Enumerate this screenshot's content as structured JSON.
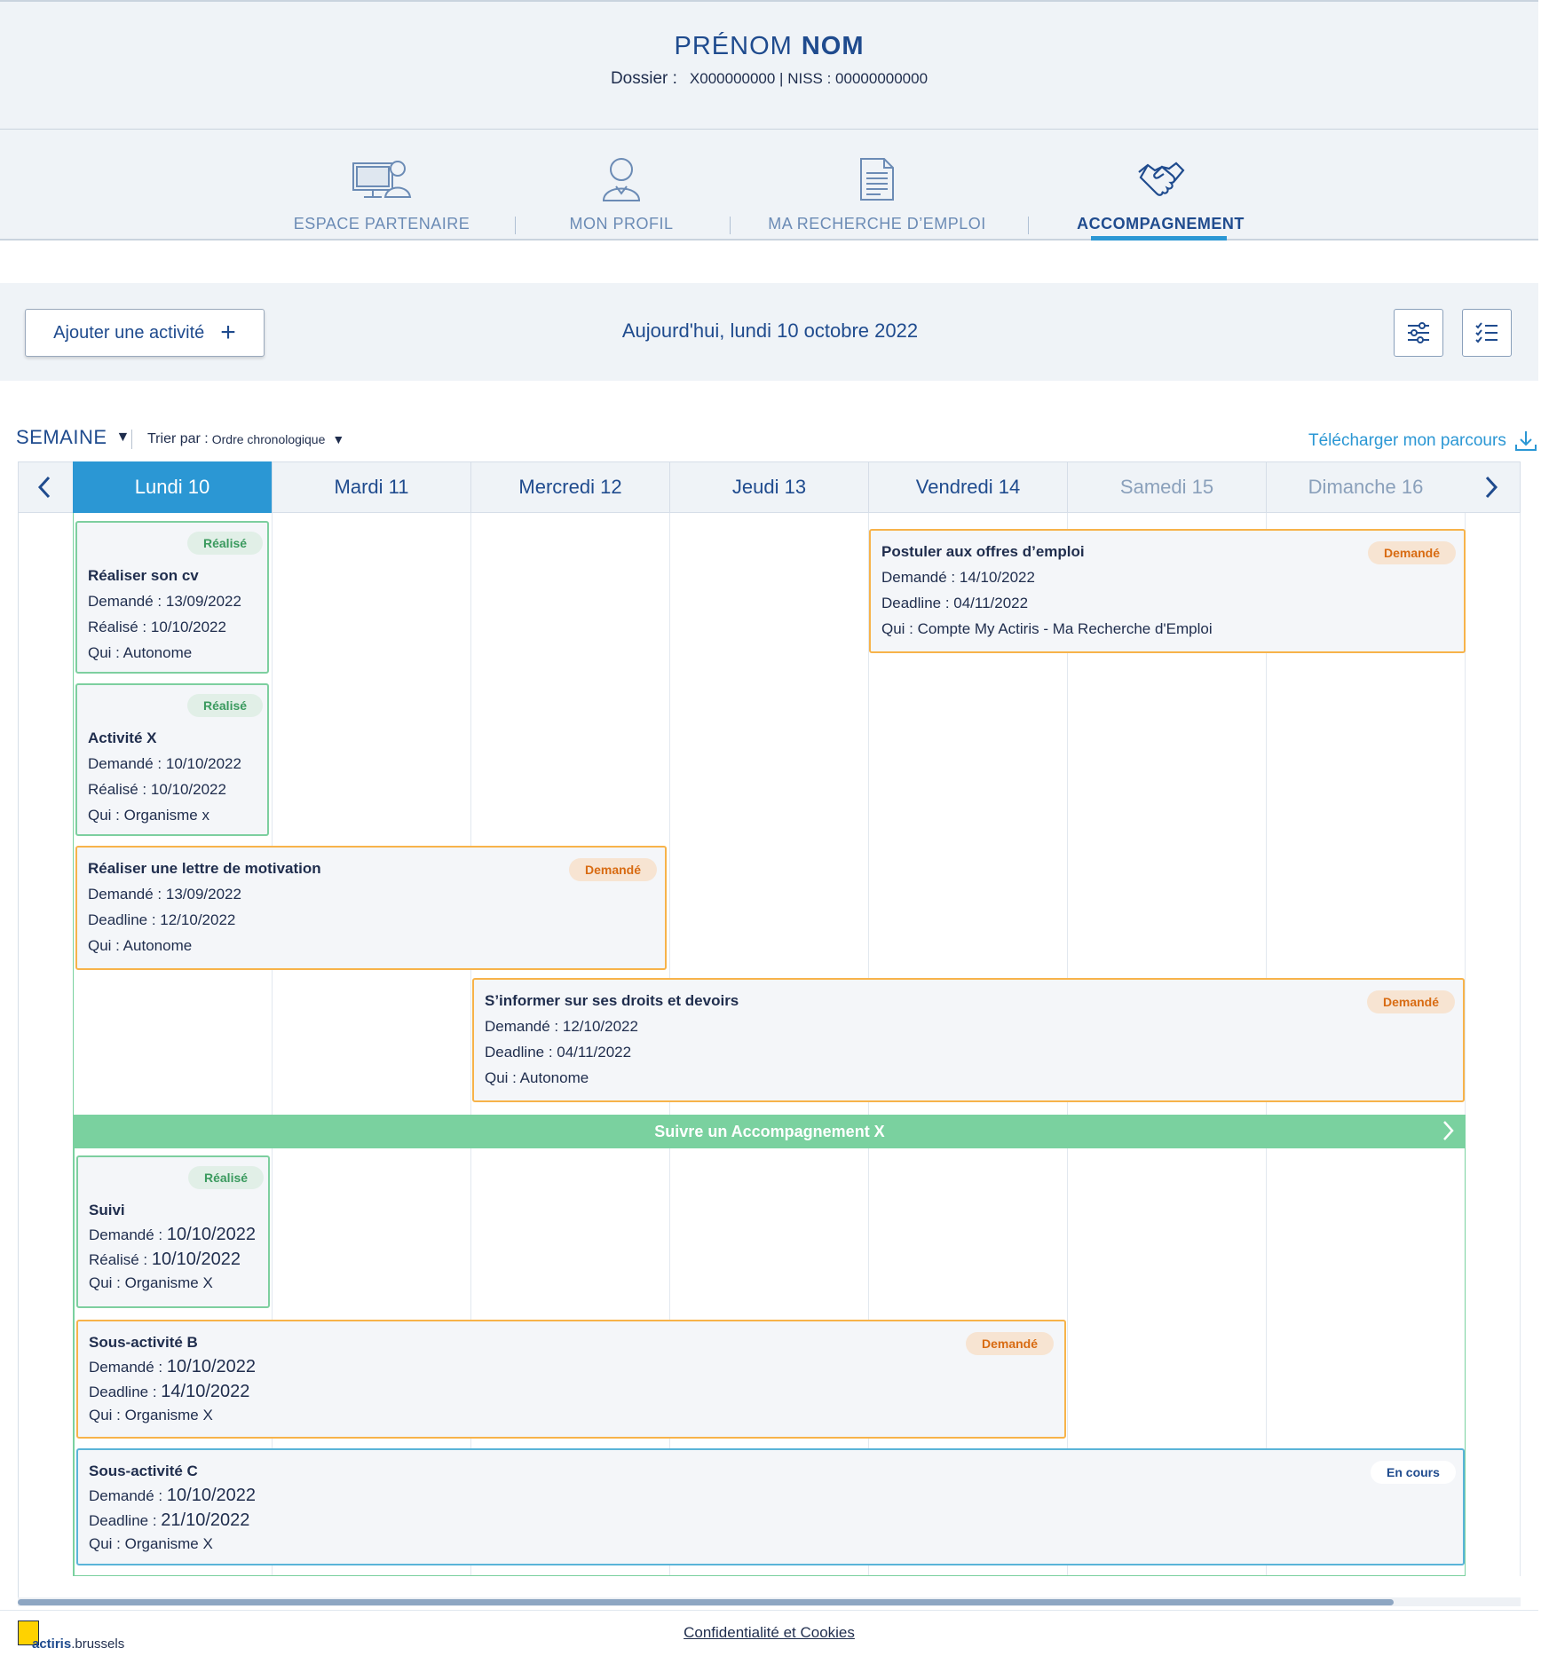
{
  "header": {
    "first_name": "PRÉNOM",
    "last_name": "NOM",
    "dossier_label": "Dossier :",
    "dossier_value": "X000000000 | NISS : 00000000000"
  },
  "nav": {
    "items": [
      {
        "label": "ESPACE PARTENAIRE",
        "icon": "computer-user-icon"
      },
      {
        "label": "MON PROFIL",
        "icon": "user-icon"
      },
      {
        "label": "MA RECHERCHE D’EMPLOI",
        "icon": "document-icon"
      },
      {
        "label": "ACCOMPAGNEMENT",
        "icon": "handshake-icon",
        "active": true
      }
    ]
  },
  "toolbar": {
    "add_label": "Ajouter une activité",
    "today": "Aujourd'hui, lundi 10 octobre 2022",
    "filter_icon": "sliders-icon",
    "checklist_icon": "checklist-icon"
  },
  "view": {
    "period": "SEMAINE",
    "sort_label": "Trier par :",
    "sort_value": "Ordre chronologique",
    "download_label": "Télécharger mon parcours"
  },
  "days": [
    "Lundi 10",
    "Mardi 11",
    "Mercredi 12",
    "Jeudi 13",
    "Vendredi 14",
    "Samedi 15",
    "Dimanche 16"
  ],
  "cards": {
    "cv": {
      "badge": "Réalisé",
      "title": "Réaliser son cv",
      "l1": "Demandé : 13/09/2022",
      "l2": "Réalisé : 10/10/2022",
      "l3": "Qui : Autonome"
    },
    "x": {
      "badge": "Réalisé",
      "title": "Activité X",
      "l1": "Demandé : 10/10/2022",
      "l2": "Réalisé : 10/10/2022",
      "l3": "Qui : Organisme x"
    },
    "postuler": {
      "badge": "Demandé",
      "title": "Postuler aux offres d’emploi",
      "l1": "Demandé : 14/10/2022",
      "l2": "Deadline : 04/11/2022",
      "l3": "Qui : Compte My Actiris - Ma Recherche d'Emploi"
    },
    "lettre": {
      "badge": "Demandé",
      "title": "Réaliser une lettre de motivation",
      "l1": "Demandé : 13/09/2022",
      "l2": "Deadline : 12/10/2022",
      "l3": "Qui : Autonome"
    },
    "droits": {
      "badge": "Demandé",
      "title": "S’informer sur ses droits et devoirs",
      "l1": "Demandé : 12/10/2022",
      "l2": "Deadline : 04/11/2022",
      "l3": "Qui : Autonome"
    },
    "suivi": {
      "badge": "Réalisé",
      "title": "Suivi",
      "l1a": "Demandé :",
      "l1b": "10/10/2022",
      "l2a": "Réalisé :",
      "l2b": "10/10/2022",
      "l3": "Qui : Organisme X"
    },
    "sousB": {
      "badge": "Demandé",
      "title": "Sous-activité B",
      "l1a": "Demandé :",
      "l1b": "10/10/2022",
      "l2a": "Deadline :",
      "l2b": "14/10/2022",
      "l3": "Qui : Organisme X"
    },
    "sousC": {
      "badge": "En cours",
      "title": "Sous-activité C",
      "l1a": "Demandé :",
      "l1b": "10/10/2022",
      "l2a": "Deadline :",
      "l2b": "21/10/2022",
      "l3": "Qui : Organisme X"
    }
  },
  "group": {
    "label": "Suivre un Accompagnement X"
  },
  "footer": {
    "privacy": "Confidentialité et Cookies",
    "logo_brand": "actiris",
    "logo_suffix": ".brussels"
  },
  "colors": {
    "accent": "#2b97d4",
    "brand": "#1f4b8e",
    "done": "#7ad19f",
    "asked": "#f7b34a"
  }
}
